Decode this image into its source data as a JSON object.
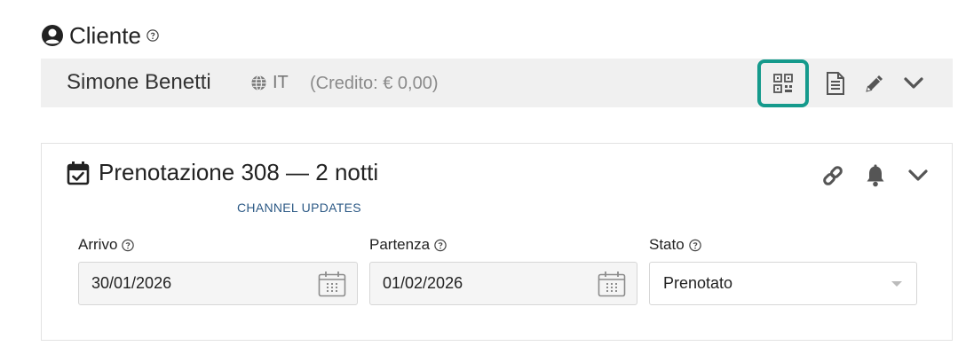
{
  "client": {
    "section_title": "Cliente",
    "name": "Simone Benetti",
    "language": "IT",
    "credit": "(Credito: € 0,00)"
  },
  "booking": {
    "title": "Prenotazione 308  —  2 notti",
    "channel_link": "CHANNEL UPDATES",
    "fields": {
      "arrival_label": "Arrivo",
      "arrival_value": "30/01/2026",
      "departure_label": "Partenza",
      "departure_value": "01/02/2026",
      "status_label": "Stato",
      "status_value": "Prenotato"
    }
  },
  "colors": {
    "highlight": "#159a8c",
    "bar_background": "#f0f0f0",
    "link": "#2d5a86"
  },
  "icons": {
    "client": "user-circle-icon",
    "help": "help-icon",
    "language": "globe-icon",
    "qr": "qr-code-icon",
    "document": "document-icon",
    "edit": "pencil-icon",
    "expand": "chevron-down-icon",
    "booking": "calendar-check-icon",
    "link": "link-icon",
    "notify": "bell-icon",
    "date_picker": "calendar-icon"
  }
}
